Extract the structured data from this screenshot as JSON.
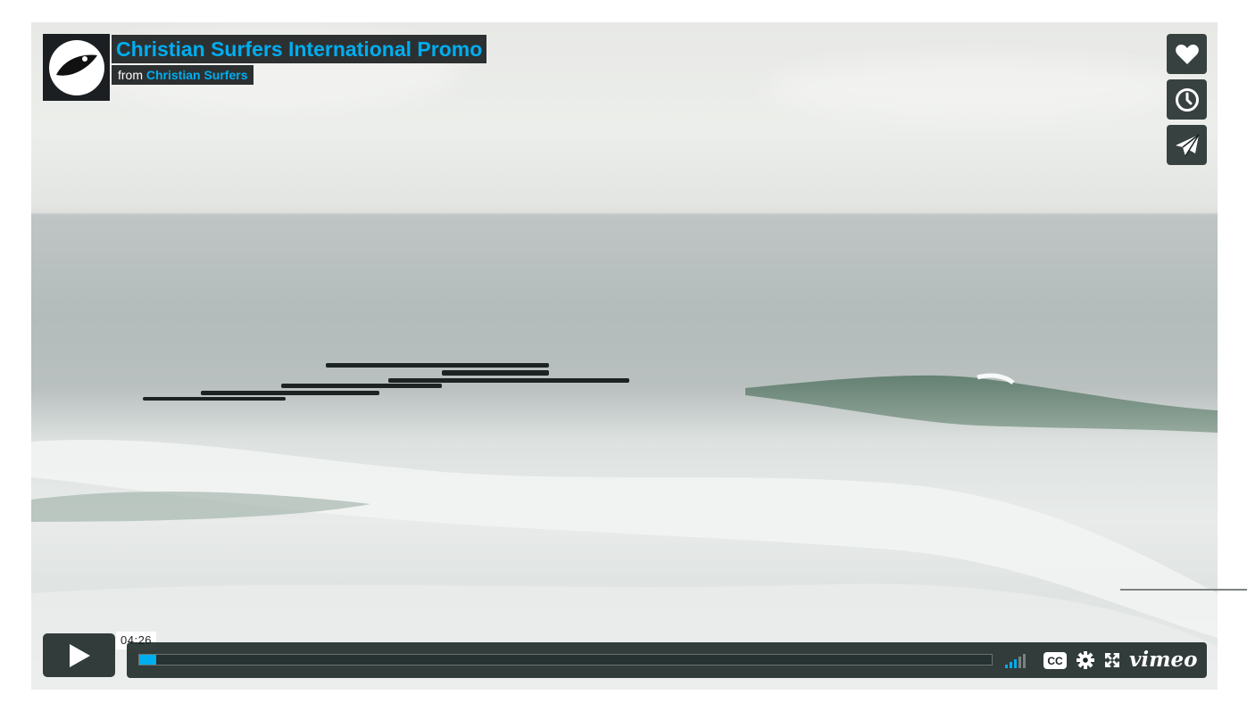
{
  "video": {
    "title": "Christian Surfers International Promo",
    "byline_prefix": "from",
    "owner": "Christian Surfers"
  },
  "side_buttons": [
    {
      "name": "like-button",
      "icon": "heart-icon"
    },
    {
      "name": "watch-later-button",
      "icon": "clock-icon"
    },
    {
      "name": "share-button",
      "icon": "paper-plane-icon"
    }
  ],
  "controls": {
    "play_icon": "play-icon",
    "duration": "04:26",
    "progress_fraction": 0.002,
    "volume_level_fraction": 0.6,
    "cc_label": "CC",
    "brand": "vimeo"
  },
  "colors": {
    "accent": "#00adef",
    "panel": "#172322",
    "text": "#ffffff"
  }
}
